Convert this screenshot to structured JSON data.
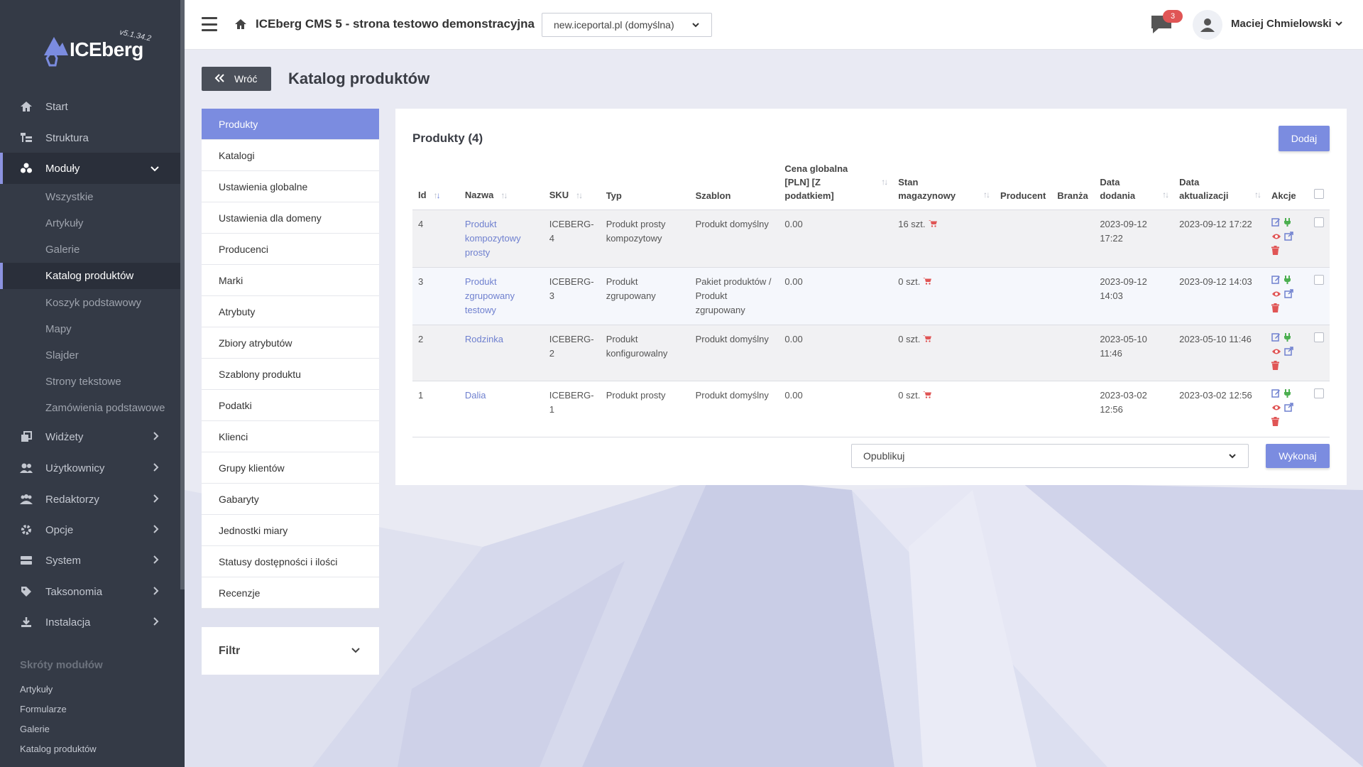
{
  "sidebar": {
    "logo_text": "ICEberg",
    "version": "v5.1.34.2",
    "nav": [
      {
        "label": "Start",
        "icon": "home-icon"
      },
      {
        "label": "Struktura",
        "icon": "sitemap-icon"
      },
      {
        "label": "Moduły",
        "icon": "cubes-icon"
      },
      {
        "label": "Widżety",
        "icon": "layers-icon"
      },
      {
        "label": "Użytkownicy",
        "icon": "users-icon"
      },
      {
        "label": "Redaktorzy",
        "icon": "editors-icon"
      },
      {
        "label": "Opcje",
        "icon": "gear-icon"
      },
      {
        "label": "System",
        "icon": "server-icon"
      },
      {
        "label": "Taksonomia",
        "icon": "tag-icon"
      },
      {
        "label": "Instalacja",
        "icon": "download-icon"
      }
    ],
    "modules_sub": [
      "Wszystkie",
      "Artykuły",
      "Galerie",
      "Katalog produktów",
      "Koszyk podstawowy",
      "Mapy",
      "Slajder",
      "Strony tekstowe",
      "Zamówienia podstawowe"
    ],
    "shortcuts_title": "Skróty modułów",
    "shortcuts": [
      "Artykuły",
      "Formularze",
      "Galerie",
      "Katalog produktów"
    ]
  },
  "topbar": {
    "site_title": "ICEberg CMS 5 - strona testowo demonstracyjna",
    "domain": "new.iceportal.pl (domyślna)",
    "messages_count": "3",
    "user_name": "Maciej Chmielowski"
  },
  "page": {
    "back_label": "Wróć",
    "title": "Katalog produktów"
  },
  "side_menu": [
    "Produkty",
    "Katalogi",
    "Ustawienia globalne",
    "Ustawienia dla domeny",
    "Producenci",
    "Marki",
    "Atrybuty",
    "Zbiory atrybutów",
    "Szablony produktu",
    "Podatki",
    "Klienci",
    "Grupy klientów",
    "Gabaryty",
    "Jednostki miary",
    "Statusy dostępności i ilości",
    "Recenzje"
  ],
  "filter_label": "Filtr",
  "products": {
    "title": "Produkty (4)",
    "add_label": "Dodaj",
    "headers": {
      "id": "Id",
      "name": "Nazwa",
      "sku": "SKU",
      "type": "Typ",
      "template": "Szablon",
      "price": "Cena globalna [PLN] [Z podatkiem]",
      "stock": "Stan magazynowy",
      "producer": "Producent",
      "industry": "Branża",
      "added": "Data dodania",
      "updated": "Data aktualizacji",
      "actions": "Akcje"
    },
    "rows": [
      {
        "id": "4",
        "name": "Produkt kompozytowy prosty",
        "sku": "ICEBERG-4",
        "type": "Produkt prosty kompozytowy",
        "template": "Produkt domyślny",
        "price": "0.00",
        "stock": "16 szt.",
        "producer": "",
        "industry": "",
        "added": "2023-09-12 17:22",
        "updated": "2023-09-12 17:22"
      },
      {
        "id": "3",
        "name": "Produkt zgrupowany testowy",
        "sku": "ICEBERG-3",
        "type": "Produkt zgrupowany",
        "template": "Pakiet produktów / Produkt zgrupowany",
        "price": "0.00",
        "stock": "0 szt.",
        "producer": "",
        "industry": "",
        "added": "2023-09-12 14:03",
        "updated": "2023-09-12 14:03"
      },
      {
        "id": "2",
        "name": "Rodzinka",
        "sku": "ICEBERG-2",
        "type": "Produkt konfigurowalny",
        "template": "Produkt domyślny",
        "price": "0.00",
        "stock": "0 szt.",
        "producer": "",
        "industry": "",
        "added": "2023-05-10 11:46",
        "updated": "2023-05-10 11:46"
      },
      {
        "id": "1",
        "name": "Dalia",
        "sku": "ICEBERG-1",
        "type": "Produkt prosty",
        "template": "Produkt domyślny",
        "price": "0.00",
        "stock": "0 szt.",
        "producer": "",
        "industry": "",
        "added": "2023-03-02 12:56",
        "updated": "2023-03-02 12:56"
      }
    ],
    "bulk_action": "Opublikuj",
    "execute_label": "Wykonaj"
  },
  "colors": {
    "accent": "#7b8ce0",
    "sidebar": "#343a46",
    "danger": "#e05555",
    "success": "#4caf50"
  }
}
